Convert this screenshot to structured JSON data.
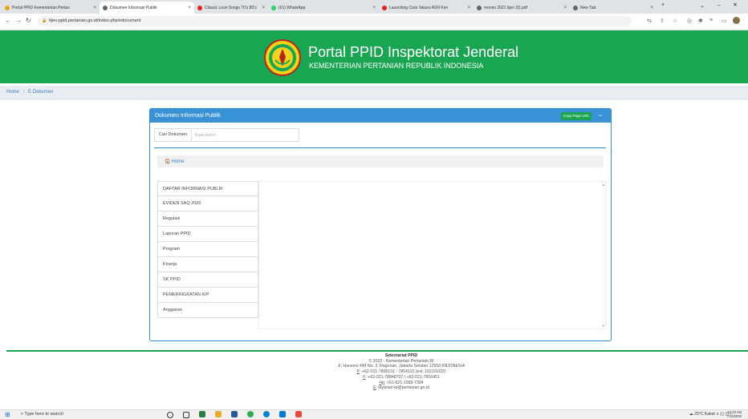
{
  "browser": {
    "tabs": [
      {
        "title": "Portal PPID Kementerian Pertan",
        "fav_color": "#e8a317"
      },
      {
        "title": "Dokumen Informasi Publik",
        "fav_color": "#5f6368"
      },
      {
        "title": "Classic Love Songs 70's 80's",
        "fav_color": "#e62117"
      },
      {
        "title": "(61) WhatsApp",
        "fav_color": "#25d366"
      },
      {
        "title": "Launching Core Values ASN Ken",
        "fav_color": "#e62117"
      },
      {
        "title": "monev 2021 itjen (5).pdf",
        "fav_color": "#5f6368"
      },
      {
        "title": "New Tab",
        "fav_color": "#5f6368"
      }
    ],
    "url": "itjen-ppid.pertanian.go.id/index.php/edocument"
  },
  "header": {
    "title": "Portal PPID Inspektorat Jenderal",
    "subtitle": "KEMENTERIAN PERTANIAN REPUBLIK INDONESIA"
  },
  "breadcrumb": {
    "home": "Home",
    "separator": "/",
    "current": "E Dokumen"
  },
  "panel": {
    "title": "Dokumen Informasi Publik",
    "copy_button": "Copy Page URL",
    "search_label": "Cari Dokumen",
    "search_placeholder": "Kata kunci",
    "home_link": "Home",
    "items": [
      "DAFTAR INFORMASI PUBLIK",
      "EVIDEN SAQ 2020",
      "Regulasi",
      "Laporan PPID",
      "Program",
      "Kinerja",
      "SK PPID",
      "PEMERINGKATAN KIP",
      "Anggaran"
    ]
  },
  "footer": {
    "org": "Sekretariat PPID",
    "copyright": "© 2022 - Kementerian Pertanian RI",
    "address": "Jl. Harsono RM No. 3, Ragunan, Jakarta Selatan 12550-INDONESIA",
    "phone_prefix": "P",
    "phone": ": +62-021-7806131 - 7804110 (ext. 1022/1032)",
    "fax_prefix": "F",
    "fax": ": +62-021-78848707 / +62-021-7816451",
    "hp_prefix": "Hp",
    "hp": ": +62-821-1589-7394",
    "email_prefix": "E",
    "email": ": layanan-ip@pertanian.go.id"
  },
  "taskbar": {
    "search_placeholder": "Type here to search",
    "weather": "29°C Kabut",
    "time": "10:28 AM",
    "date": "7/13/2022"
  }
}
